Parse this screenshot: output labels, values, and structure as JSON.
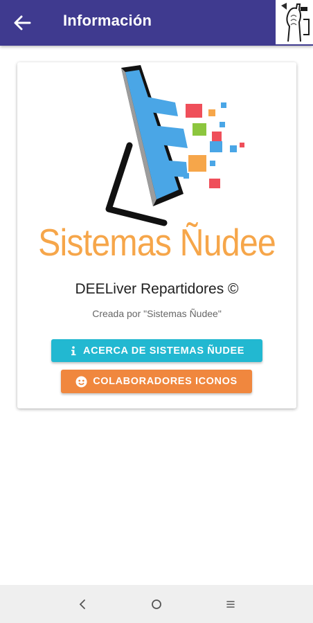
{
  "appbar": {
    "title": "Información",
    "color": "#3f3a8f"
  },
  "card": {
    "brand": "Sistemas Ñudee",
    "app_name": "DEELiver Repartidores ©",
    "credit": "Creada por \"Sistemas Ñudee\"",
    "buttons": {
      "about_label": "ACERCA DE SISTEMAS ÑUDEE",
      "about_icon": "info-icon",
      "about_color": "#22b8d1",
      "collab_label": "COLABORADORES ICONOS",
      "collab_icon": "face-icon",
      "collab_color": "#f0873e"
    }
  },
  "navbar": {
    "back_icon": "chevron-left-icon",
    "home_icon": "circle-icon",
    "recents_icon": "menu-lines-icon"
  }
}
